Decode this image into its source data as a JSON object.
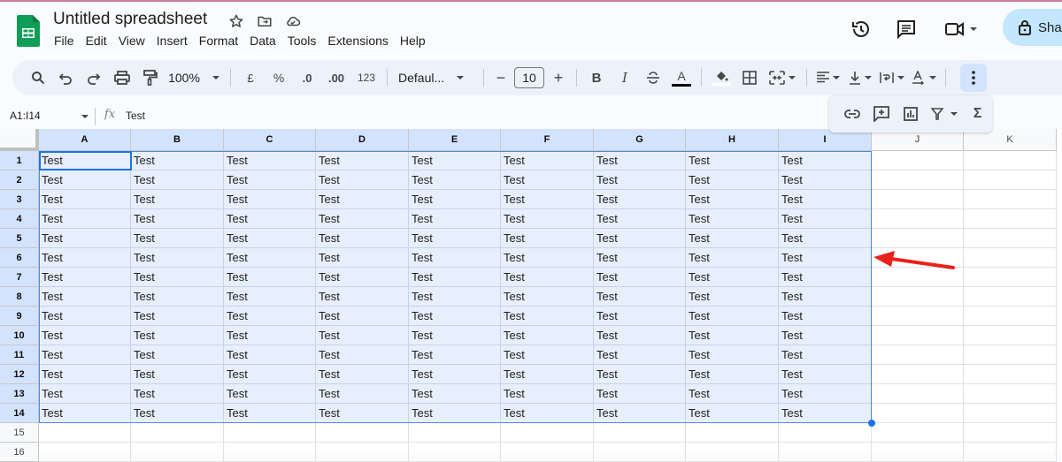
{
  "app": {
    "title": "Untitled spreadsheet",
    "title_icons": [
      "star-icon",
      "move-to-folder-icon",
      "cloud-saved-icon"
    ],
    "menu": [
      "File",
      "Edit",
      "View",
      "Insert",
      "Format",
      "Data",
      "Tools",
      "Extensions",
      "Help"
    ],
    "right_icons": [
      "version-history-icon",
      "comments-icon",
      "meet-icon"
    ],
    "share_label": "Sha"
  },
  "toolbar": {
    "zoom": "100%",
    "currency": "£",
    "percent": "%",
    "decrease_decimal": ".0",
    "increase_decimal": ".00",
    "number_format": "123",
    "font": "Defaul...",
    "font_size": "10",
    "minus": "−",
    "plus": "+",
    "bold": "B",
    "italic": "I",
    "text_color": "A",
    "more_label": "⋮"
  },
  "popup": {
    "items": [
      "insert-link-icon",
      "insert-comment-icon",
      "insert-chart-icon",
      "filter-icon",
      "functions-icon"
    ],
    "sigma": "Σ"
  },
  "formula_bar": {
    "name_box": "A1:I14",
    "fx": "fx",
    "value": "Test"
  },
  "sheet": {
    "columns": [
      "A",
      "B",
      "C",
      "D",
      "E",
      "F",
      "G",
      "H",
      "I",
      "J",
      "K"
    ],
    "rows": [
      "1",
      "2",
      "3",
      "4",
      "5",
      "6",
      "7",
      "8",
      "9",
      "10",
      "11",
      "12",
      "13",
      "14",
      "15",
      "16"
    ],
    "cell_value": "Test",
    "filled_rows": 14,
    "filled_cols": 9,
    "selection": "A1:I14"
  },
  "colors": {
    "accent": "#1a73e8",
    "selection_fill": "#e7effd",
    "header_selected": "#d3e3fd",
    "share_button": "#c2e7ff",
    "annotation_arrow": "#e8221b"
  }
}
